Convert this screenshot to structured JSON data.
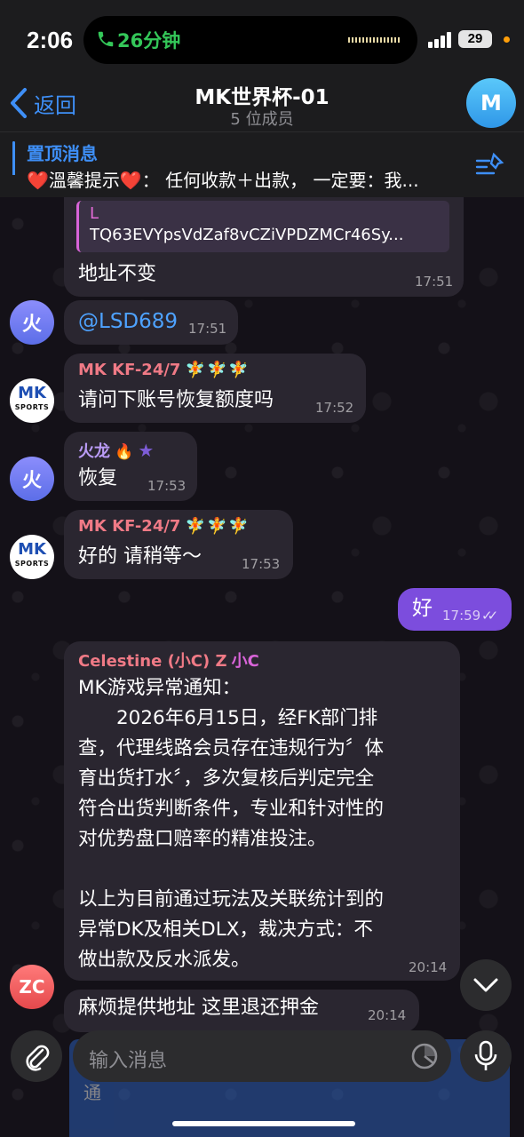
{
  "status_bar": {
    "time": "2:06",
    "call_duration": "26分钟",
    "battery": "29"
  },
  "header": {
    "back_label": "返回",
    "title": "MK世界杯-01",
    "subtitle": "5 位成员",
    "avatar_letter": "M"
  },
  "pinned": {
    "title": "置顶消息",
    "text": "❤️溫馨提示❤️： 任何收款＋出款， 一定要：我..."
  },
  "messages": [
    {
      "quote_name": "L",
      "quote_text": "TQ63EVYpsVdZaf8vCZiVPDZMCr46Sy...",
      "text": "地址不变",
      "time": "17:51"
    },
    {
      "avatar": "火",
      "text": "@LSD689",
      "time": "17:51"
    },
    {
      "avatar_top": "MK",
      "avatar_bottom": "SPORTS",
      "sender": "MK KF-24/7",
      "sender_emoji": "🧚🧚🧚",
      "text": "请问下账号恢复额度吗",
      "time": "17:52"
    },
    {
      "avatar": "火",
      "sender": "火龙",
      "sender_emoji": "🔥",
      "badge": "★",
      "text": "恢复",
      "time": "17:53"
    },
    {
      "avatar_top": "MK",
      "avatar_bottom": "SPORTS",
      "sender": "MK KF-24/7",
      "sender_emoji": "🧚🧚🧚",
      "text": "好的 请稍等～",
      "time": "17:53"
    },
    {
      "text": "好",
      "time": "17:59",
      "read_mark": "✓✓"
    },
    {
      "sender": "Celestine (小C) Z",
      "sender_tag": "小C",
      "lines": [
        "MK游戏异常通知：",
        "　　2026年6月15日，经FK部门排",
        "查，代理线路会员存在违规行为〞体",
        "育出货打水〞，多次复核后判定完全",
        "符合出货判断条件，专业和针对性的",
        "对优势盘口赔率的精准投注。",
        "",
        "以上为目前通过玩法及关联统计到的",
        "异常DK及相关DLX，裁决方式：不",
        "做出款及反水派发。"
      ],
      "time": "20:14"
    },
    {
      "avatar": "ZC",
      "text": "麻烦提供地址 这里退还押金",
      "time": "20:14"
    }
  ],
  "input": {
    "placeholder": "输入消息"
  },
  "underlay": {
    "text": "通"
  },
  "colors": {
    "accent": "#3e8ff7",
    "outgoing_bubble": "#7c4ddd",
    "incoming_bubble": "#2a2630",
    "sender_mk": "#f07a86",
    "sender_huolong": "#b99bf5",
    "sender_celestine": "#f07a86"
  }
}
